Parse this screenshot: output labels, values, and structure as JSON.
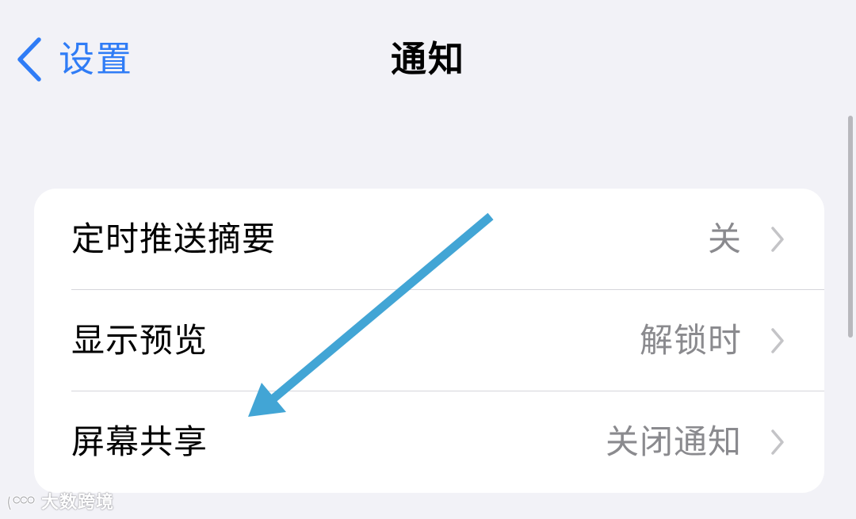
{
  "nav": {
    "back_label": "设置",
    "title": "通知"
  },
  "settings": [
    {
      "label": "定时推送摘要",
      "value": "关"
    },
    {
      "label": "显示预览",
      "value": "解锁时"
    },
    {
      "label": "屏幕共享",
      "value": "关闭通知"
    }
  ],
  "watermark": {
    "text": "大数跨境"
  },
  "icons": {
    "back": "chevron-left-icon",
    "row_disclosure": "chevron-right-icon",
    "annotation": "arrow-icon",
    "watermark_logo": "logo-icon"
  },
  "colors": {
    "background": "#f2f2f7",
    "card": "#ffffff",
    "accent": "#2f7cf6",
    "secondary_text": "#8a8a8e",
    "annotation_arrow": "#42a5d5"
  }
}
